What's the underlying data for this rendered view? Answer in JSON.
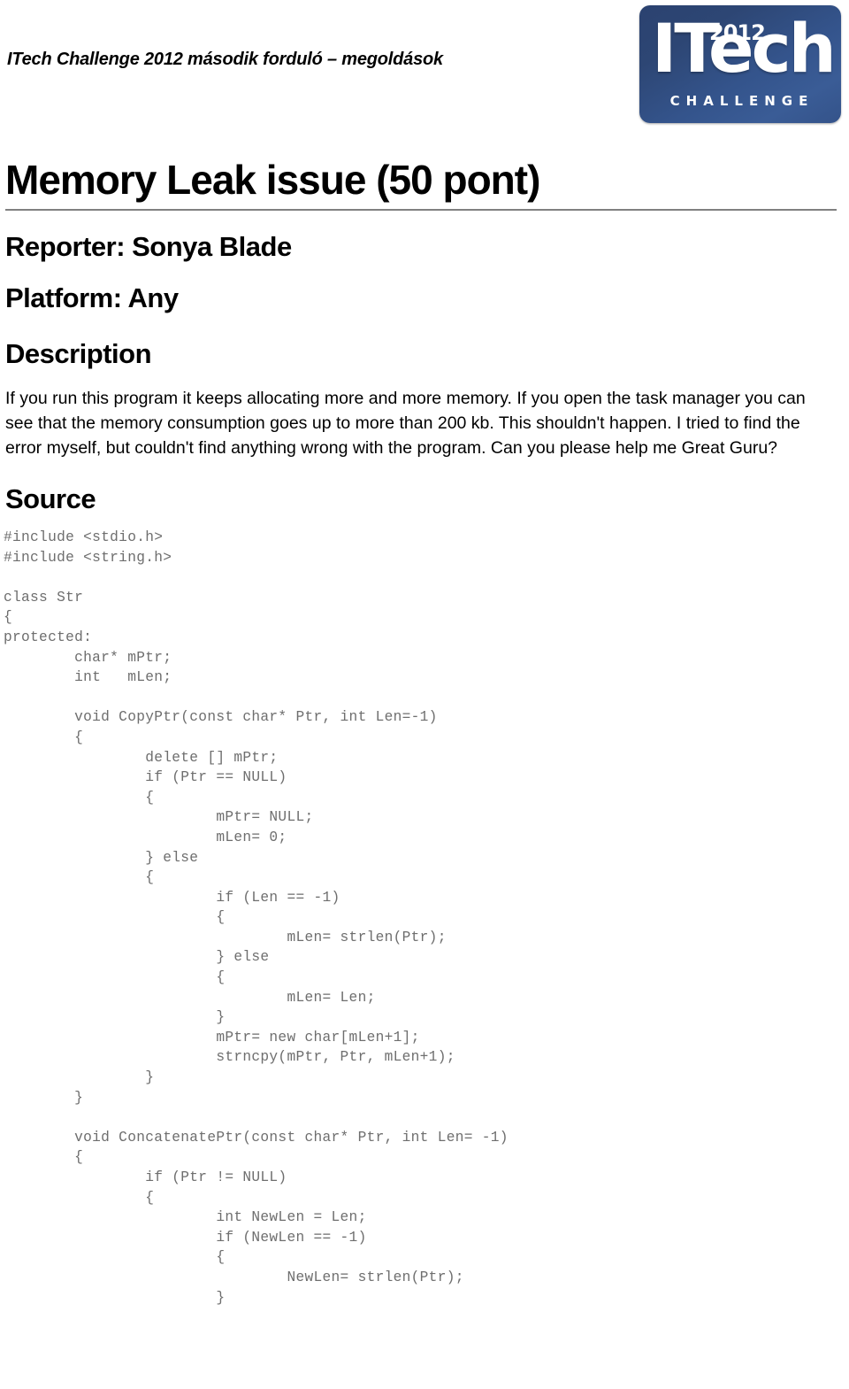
{
  "header": {
    "title": "ITech Challenge 2012 második forduló – megoldások",
    "logo": {
      "word": "ITech",
      "year": "2012",
      "subtitle": "CHALLENGE",
      "bg_color_top": "#2b4270",
      "bg_color_bottom": "#34538a",
      "text_color": "#ffffff"
    }
  },
  "document": {
    "title": "Memory Leak issue (50 pont)",
    "reporter_line": "Reporter: Sonya Blade",
    "platform_line": "Platform: Any",
    "description_heading": "Description",
    "description_text": "If you run this program it keeps allocating more and more memory. If you open the task manager you can see that the memory consumption goes up to more than 200 kb. This shouldn't happen. I tried to find the error myself, but couldn't find anything wrong with the program. Can you please help me Great Guru?",
    "source_heading": "Source",
    "source_code": "#include <stdio.h>\n#include <string.h>\n\nclass Str\n{\nprotected:\n        char* mPtr;\n        int   mLen;\n\n        void CopyPtr(const char* Ptr, int Len=-1)\n        {\n                delete [] mPtr;\n                if (Ptr == NULL)\n                {\n                        mPtr= NULL;\n                        mLen= 0;\n                } else\n                {\n                        if (Len == -1)\n                        {\n                                mLen= strlen(Ptr);\n                        } else\n                        {\n                                mLen= Len;\n                        }\n                        mPtr= new char[mLen+1];\n                        strncpy(mPtr, Ptr, mLen+1);\n                }\n        }\n\n        void ConcatenatePtr(const char* Ptr, int Len= -1)\n        {\n                if (Ptr != NULL)\n                {\n                        int NewLen = Len;\n                        if (NewLen == -1)\n                        {\n                                NewLen= strlen(Ptr);\n                        }"
  }
}
